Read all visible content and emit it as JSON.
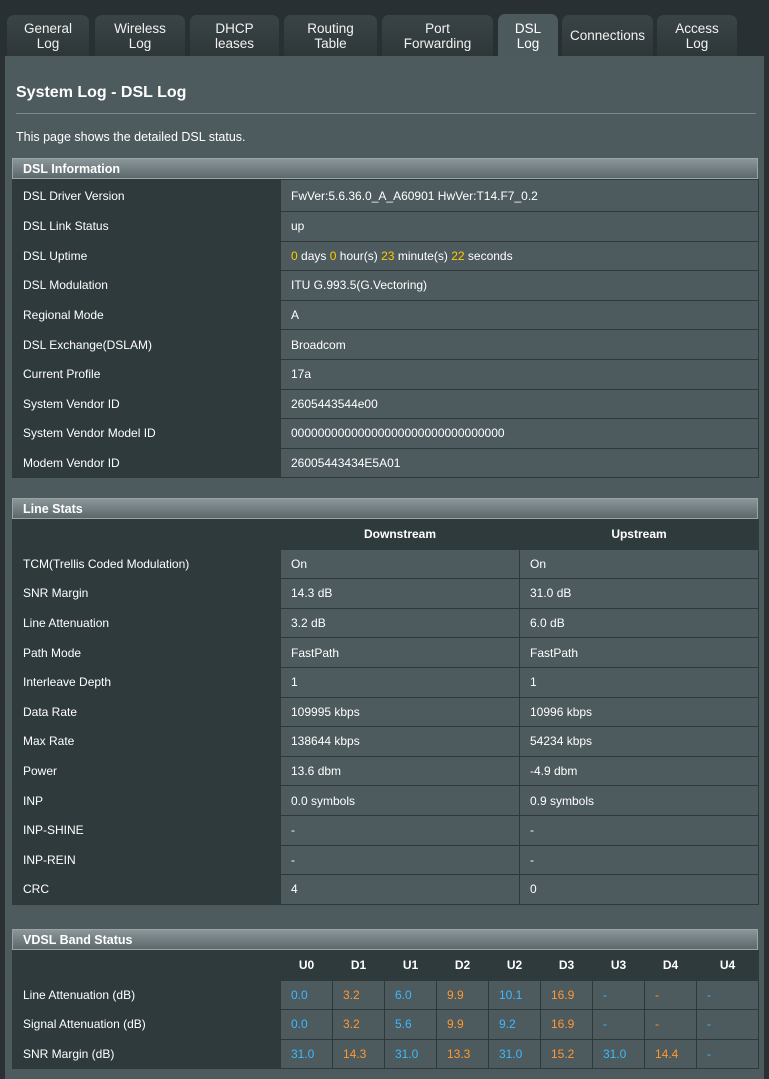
{
  "tabs": [
    {
      "label": "General\nLog"
    },
    {
      "label": "Wireless\nLog"
    },
    {
      "label": "DHCP\nleases"
    },
    {
      "label": "Routing\nTable"
    },
    {
      "label": "Port\nForwarding"
    },
    {
      "label": "DSL\nLog"
    },
    {
      "label": "Connections"
    },
    {
      "label": "Access\nLog"
    }
  ],
  "page": {
    "title": "System Log - DSL Log",
    "description": "This page shows the detailed DSL status."
  },
  "dsl_info": {
    "header": "DSL Information",
    "rows": [
      {
        "label": "DSL Driver Version",
        "value": "FwVer:5.6.36.0_A_A60901 HwVer:T14.F7_0.2"
      },
      {
        "label": "DSL Link Status",
        "value": "up"
      },
      {
        "label": "DSL Uptime",
        "value": ""
      },
      {
        "label": "DSL Modulation",
        "value": "ITU G.993.5(G.Vectoring)"
      },
      {
        "label": "Regional Mode",
        "value": "A"
      },
      {
        "label": "DSL Exchange(DSLAM)",
        "value": "Broadcom"
      },
      {
        "label": "Current Profile",
        "value": "17a"
      },
      {
        "label": "System Vendor ID",
        "value": "2605443544e00"
      },
      {
        "label": "System Vendor Model ID",
        "value": "00000000000000000000000000000000"
      },
      {
        "label": "Modem Vendor ID",
        "value": "26005443434E5A01"
      }
    ],
    "uptime": {
      "days": "0",
      "days_unit": "days",
      "hours": "0",
      "hours_unit": "hour(s)",
      "minutes": "23",
      "minutes_unit": "minute(s)",
      "seconds": "22",
      "seconds_unit": "seconds"
    }
  },
  "line_stats": {
    "header": "Line Stats",
    "col_down": "Downstream",
    "col_up": "Upstream",
    "rows": [
      {
        "label": "TCM(Trellis Coded Modulation)",
        "down": "On",
        "up": "On"
      },
      {
        "label": "SNR Margin",
        "down": "14.3 dB",
        "up": "31.0 dB"
      },
      {
        "label": "Line Attenuation",
        "down": "3.2 dB",
        "up": "6.0 dB"
      },
      {
        "label": "Path Mode",
        "down": "FastPath",
        "up": "FastPath"
      },
      {
        "label": "Interleave Depth",
        "down": "1",
        "up": "1"
      },
      {
        "label": "Data Rate",
        "down": "109995 kbps",
        "up": "10996 kbps"
      },
      {
        "label": "Max Rate",
        "down": "138644 kbps",
        "up": "54234 kbps"
      },
      {
        "label": "Power",
        "down": "13.6 dbm",
        "up": "-4.9 dbm"
      },
      {
        "label": "INP",
        "down": "0.0 symbols",
        "up": "0.9 symbols"
      },
      {
        "label": "INP-SHINE",
        "down": "-",
        "up": "-"
      },
      {
        "label": "INP-REIN",
        "down": "-",
        "up": "-"
      },
      {
        "label": "CRC",
        "down": "4",
        "up": "0"
      }
    ]
  },
  "band_status": {
    "header": "VDSL Band Status",
    "bands": [
      "U0",
      "D1",
      "U1",
      "D2",
      "U2",
      "D3",
      "U3",
      "D4",
      "U4"
    ],
    "rows": [
      {
        "label": "Line Attenuation (dB)",
        "values": [
          "0.0",
          "3.2",
          "6.0",
          "9.9",
          "10.1",
          "16.9",
          "-",
          "-",
          "-"
        ]
      },
      {
        "label": "Signal Attenuation (dB)",
        "values": [
          "0.0",
          "3.2",
          "5.6",
          "9.9",
          "9.2",
          "16.9",
          "-",
          "-",
          "-"
        ]
      },
      {
        "label": "SNR Margin (dB)",
        "values": [
          "31.0",
          "14.3",
          "31.0",
          "13.3",
          "31.0",
          "15.2",
          "31.0",
          "14.4",
          "-"
        ]
      }
    ]
  },
  "colors": {
    "upstream_value": "#40b8ff",
    "downstream_value": "#ff9933",
    "uptime_number": "#ffcc00"
  }
}
